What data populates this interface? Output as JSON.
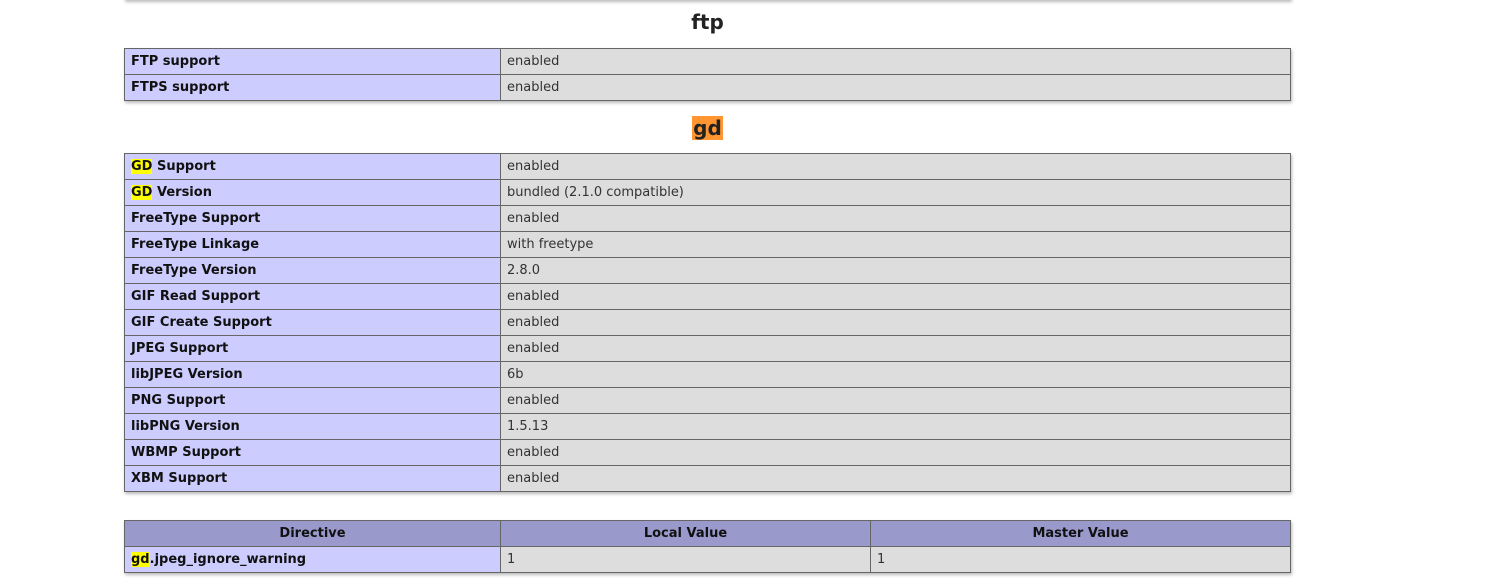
{
  "ftp": {
    "title": "ftp",
    "rows": [
      {
        "key": "FTP support",
        "value": "enabled"
      },
      {
        "key": "FTPS support",
        "value": "enabled"
      }
    ]
  },
  "gd": {
    "title": "gd",
    "rows": [
      {
        "key_hl": "GD",
        "key_rest": " Support",
        "value": "enabled"
      },
      {
        "key_hl": "GD",
        "key_rest": " Version",
        "value": "bundled (2.1.0 compatible)"
      },
      {
        "key_hl": "",
        "key_rest": "FreeType Support",
        "value": "enabled"
      },
      {
        "key_hl": "",
        "key_rest": "FreeType Linkage",
        "value": "with freetype"
      },
      {
        "key_hl": "",
        "key_rest": "FreeType Version",
        "value": "2.8.0"
      },
      {
        "key_hl": "",
        "key_rest": "GIF Read Support",
        "value": "enabled"
      },
      {
        "key_hl": "",
        "key_rest": "GIF Create Support",
        "value": "enabled"
      },
      {
        "key_hl": "",
        "key_rest": "JPEG Support",
        "value": "enabled"
      },
      {
        "key_hl": "",
        "key_rest": "libJPEG Version",
        "value": "6b"
      },
      {
        "key_hl": "",
        "key_rest": "PNG Support",
        "value": "enabled"
      },
      {
        "key_hl": "",
        "key_rest": "libPNG Version",
        "value": "1.5.13"
      },
      {
        "key_hl": "",
        "key_rest": "WBMP Support",
        "value": "enabled"
      },
      {
        "key_hl": "",
        "key_rest": "XBM Support",
        "value": "enabled"
      }
    ],
    "directives": {
      "headers": {
        "directive": "Directive",
        "local": "Local Value",
        "master": "Master Value"
      },
      "rows": [
        {
          "name_hl": "gd",
          "name_rest": ".jpeg_ignore_warning",
          "local": "1",
          "master": "1"
        }
      ]
    }
  },
  "colors": {
    "key_bg": "#ccccff",
    "value_bg": "#dddddd",
    "header_bg": "#9999cc",
    "search_highlight": "#ffff00",
    "current_match_highlight": "#ff9632"
  }
}
